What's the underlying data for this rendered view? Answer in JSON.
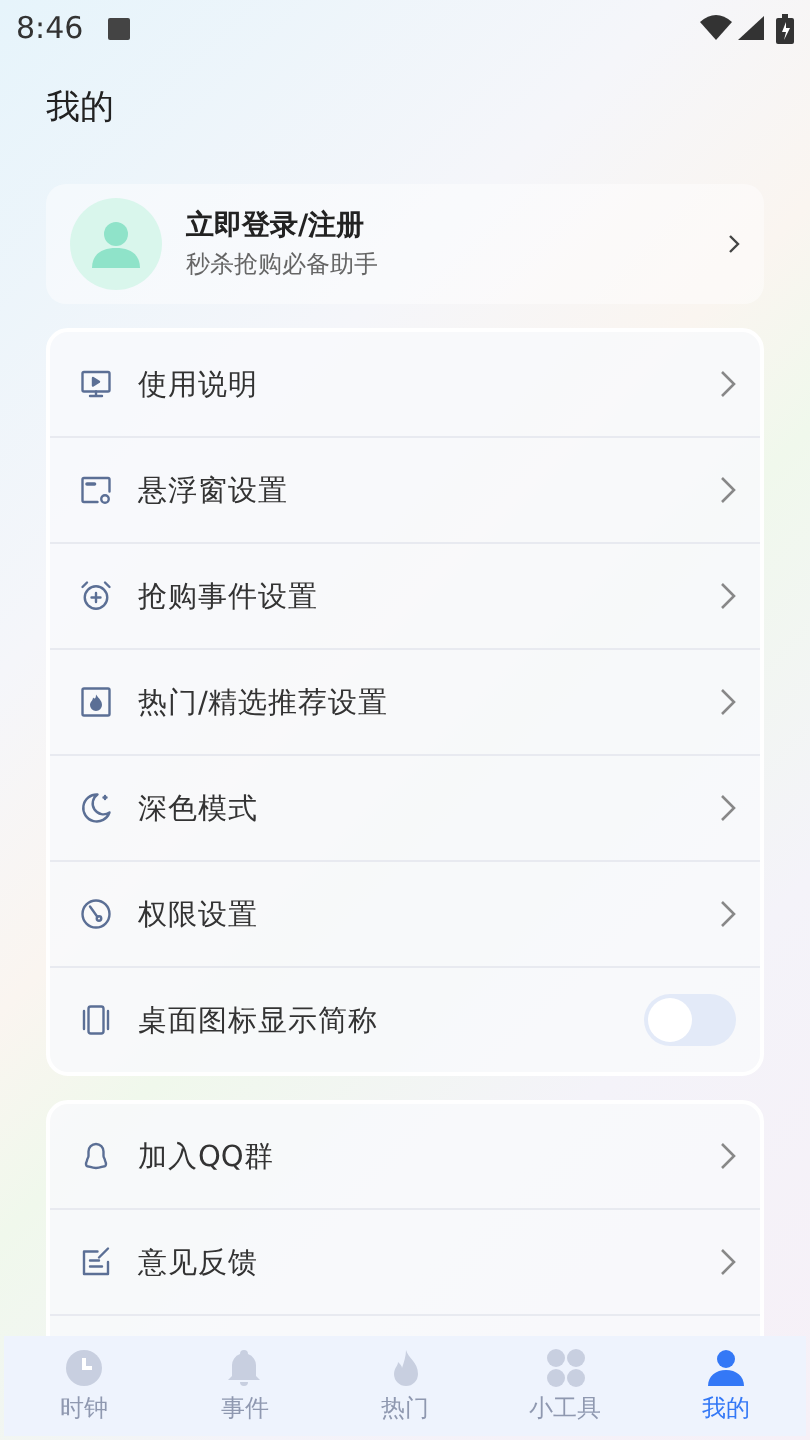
{
  "status_bar": {
    "time": "8:46"
  },
  "header": {
    "title": "我的"
  },
  "profile": {
    "name": "立即登录/注册",
    "subtitle": "秒杀抢购必备助手"
  },
  "settings_groups": [
    {
      "items": [
        {
          "kind": "link",
          "label": "使用说明"
        },
        {
          "kind": "link",
          "label": "悬浮窗设置"
        },
        {
          "kind": "link",
          "label": "抢购事件设置"
        },
        {
          "kind": "link",
          "label": "热门/精选推荐设置"
        },
        {
          "kind": "link",
          "label": "深色模式"
        },
        {
          "kind": "link",
          "label": "权限设置"
        },
        {
          "kind": "toggle",
          "label": "桌面图标显示简称",
          "on": false
        }
      ]
    },
    {
      "items": [
        {
          "kind": "link",
          "label": "加入QQ群"
        },
        {
          "kind": "link",
          "label": "意见反馈"
        }
      ]
    }
  ],
  "tab_bar": [
    {
      "label": "时钟",
      "selected": false
    },
    {
      "label": "事件",
      "selected": false
    },
    {
      "label": "热门",
      "selected": false
    },
    {
      "label": "小工具",
      "selected": false
    },
    {
      "label": "我的",
      "selected": true
    }
  ]
}
